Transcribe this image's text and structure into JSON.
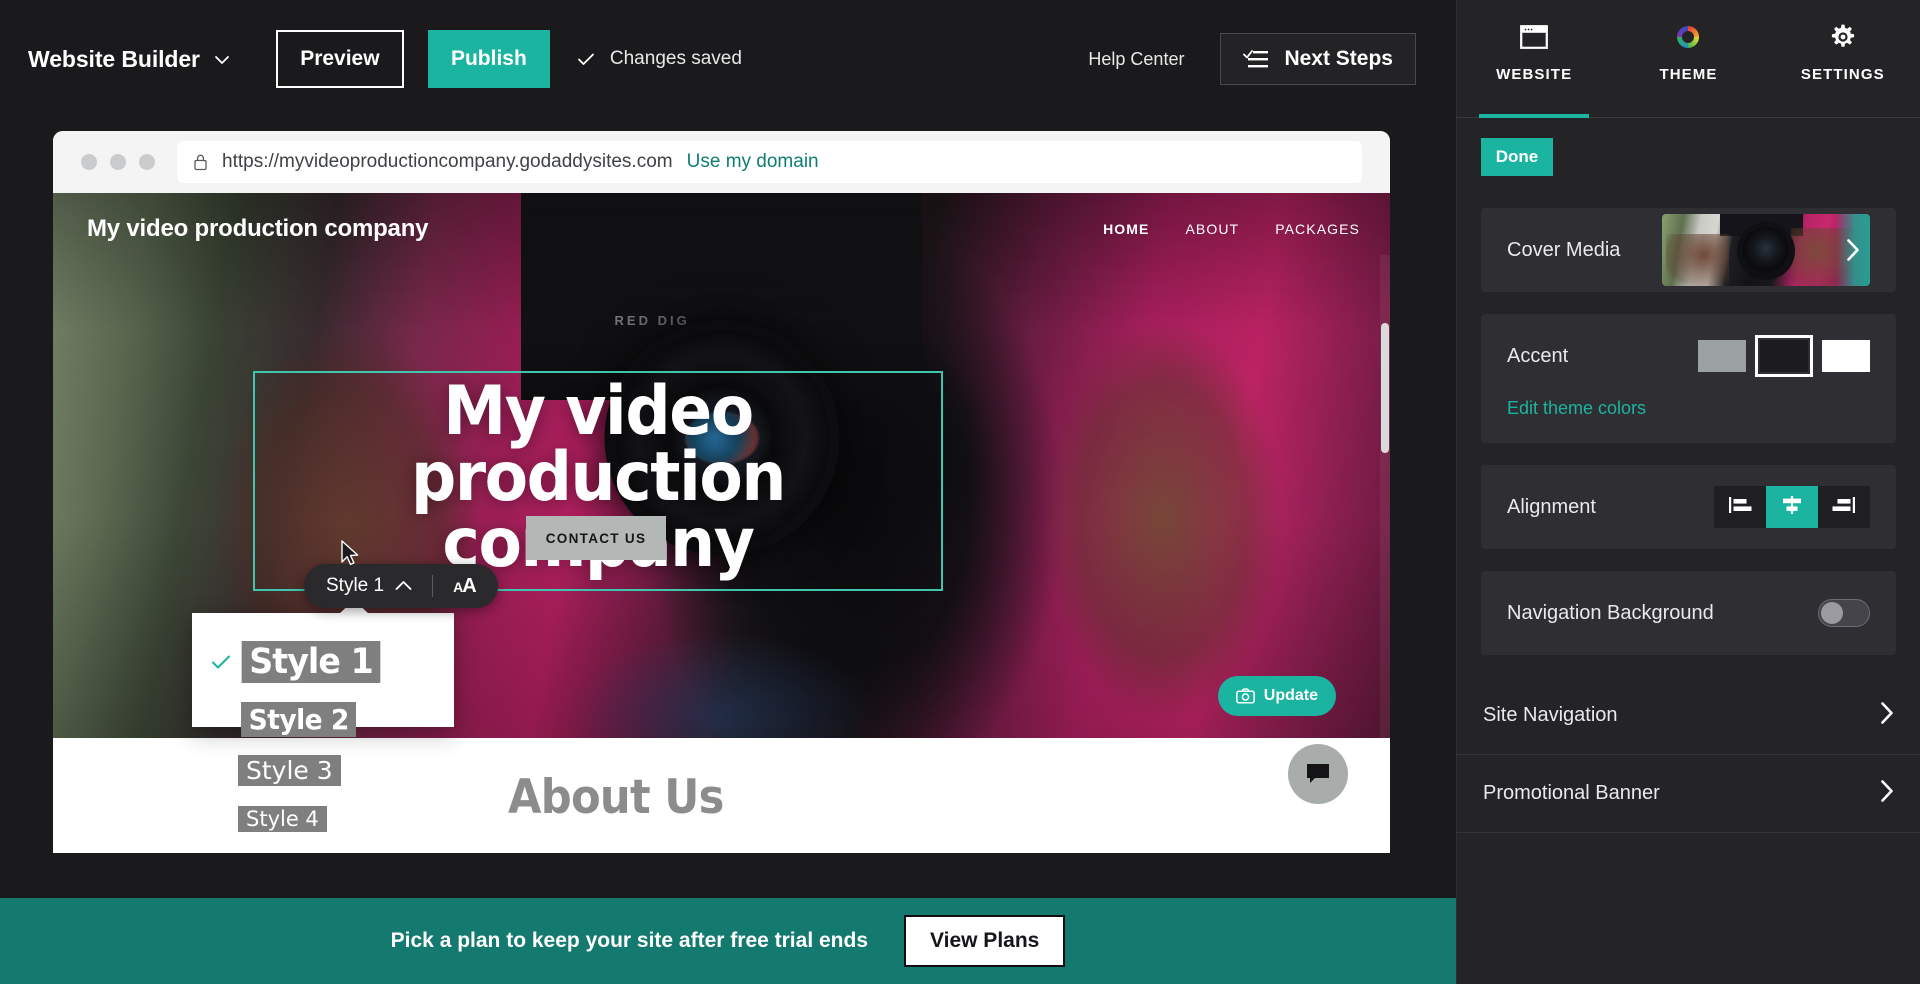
{
  "topbar": {
    "brand": "Website Builder",
    "preview_label": "Preview",
    "publish_label": "Publish",
    "saved_text": "Changes saved",
    "help_center": "Help Center",
    "next_steps": "Next Steps"
  },
  "browser": {
    "url": "https://myvideoproductioncompany.godaddysites.com",
    "use_my_domain": "Use my domain"
  },
  "site": {
    "title": "My video production company",
    "nav": [
      {
        "label": "HOME",
        "active": true
      },
      {
        "label": "ABOUT",
        "active": false
      },
      {
        "label": "PACKAGES",
        "active": false
      }
    ],
    "headline_line1": "My video production",
    "headline_line2": "company",
    "contact_button": "CONTACT US",
    "update_button": "Update",
    "about_heading": "About Us"
  },
  "style_toolbar": {
    "current_style": "Style 1",
    "font_size_icon": "AA"
  },
  "style_menu": {
    "options": [
      {
        "label": "Style 1",
        "selected": true
      },
      {
        "label": "Style 2",
        "selected": false
      },
      {
        "label": "Style 3",
        "selected": false
      },
      {
        "label": "Style 4",
        "selected": false
      }
    ]
  },
  "promo": {
    "text": "Pick a plan to keep your site after free trial ends",
    "button": "View Plans"
  },
  "sidebar": {
    "tabs": [
      {
        "label": "WEBSITE",
        "icon": "window-icon",
        "active": true
      },
      {
        "label": "THEME",
        "icon": "color-wheel-icon",
        "active": false
      },
      {
        "label": "SETTINGS",
        "icon": "gear-icon",
        "active": false
      }
    ],
    "done_label": "Done",
    "cover_media_label": "Cover Media",
    "accent_label": "Accent",
    "accent_swatches": [
      {
        "color": "#9ba0a3",
        "selected": false
      },
      {
        "color": "#1c1c1e",
        "selected": true
      },
      {
        "color": "#ffffff",
        "selected": false
      }
    ],
    "edit_theme_colors": "Edit theme colors",
    "alignment_label": "Alignment",
    "alignment_options": [
      {
        "value": "left",
        "selected": false
      },
      {
        "value": "center",
        "selected": true
      },
      {
        "value": "right",
        "selected": false
      }
    ],
    "navigation_background_label": "Navigation Background",
    "navigation_background_on": false,
    "links": [
      {
        "label": "Site Navigation"
      },
      {
        "label": "Promotional Banner"
      }
    ]
  },
  "colors": {
    "accent_teal": "#1bb4a0",
    "banner_teal": "#147a70",
    "panel_bg": "#242427",
    "card_bg": "#2e2e33",
    "topbar_bg": "#1a1a1c",
    "selection_outline": "#3ec7ae"
  }
}
